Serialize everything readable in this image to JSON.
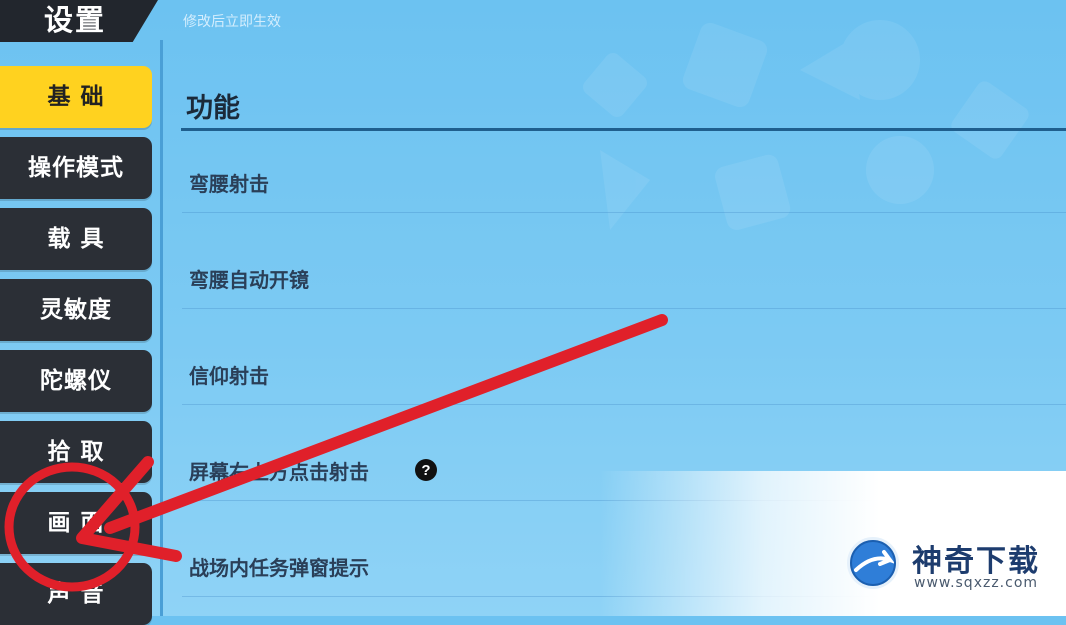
{
  "header": {
    "title": "设置",
    "hint": "修改后立即生效"
  },
  "sidebar": {
    "items": [
      {
        "label": "基 础",
        "active": true
      },
      {
        "label": "操作模式",
        "active": false
      },
      {
        "label": "载 具",
        "active": false
      },
      {
        "label": "灵敏度",
        "active": false
      },
      {
        "label": "陀螺仪",
        "active": false
      },
      {
        "label": "拾 取",
        "active": false
      },
      {
        "label": "画 面",
        "active": false
      },
      {
        "label": "声 音",
        "active": false
      }
    ]
  },
  "main": {
    "section_title": "功能",
    "options": [
      {
        "label": "弯腰射击"
      },
      {
        "label": "弯腰自动开镜"
      },
      {
        "label": "信仰射击"
      },
      {
        "label": "屏幕右上方点击射击",
        "help_icon": "question-circle-icon"
      },
      {
        "label": "战场内任务弹窗提示"
      }
    ]
  },
  "watermark": {
    "title": "神奇下载",
    "url": "www.sqxzz.com",
    "logo_icon": "globe-arrow-icon"
  },
  "annotation": {
    "arrow_color": "#e0202a",
    "highlighted_item": "画 面"
  },
  "colors": {
    "active_tab": "#ffd21f",
    "tab_bg": "#2b2f36",
    "background": "#7ccaf3"
  }
}
